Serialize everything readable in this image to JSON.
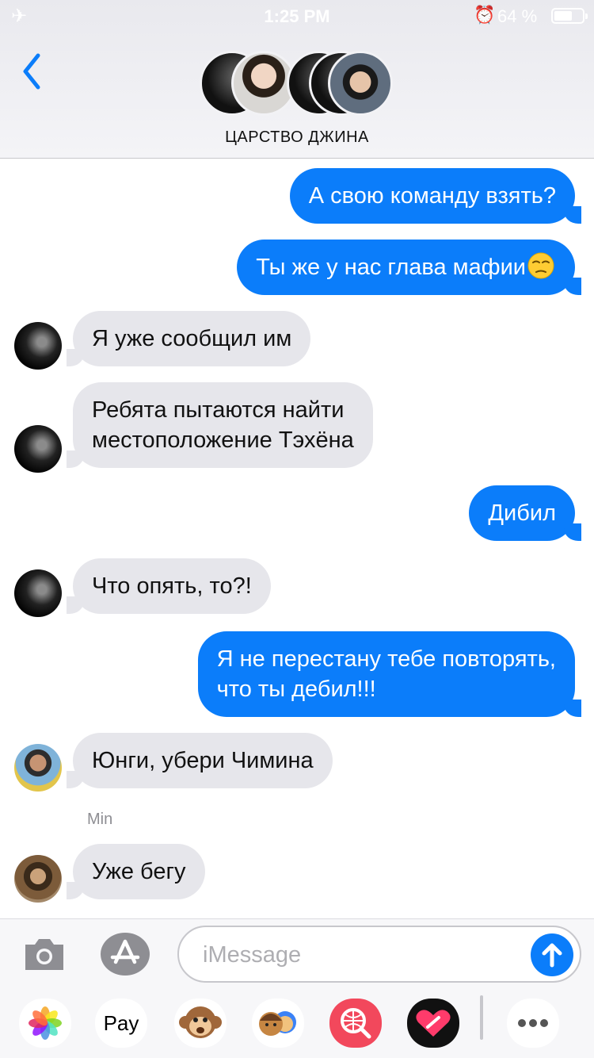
{
  "status_bar": {
    "time": "1:25 PM",
    "battery_percent": "64 %",
    "battery_level": 0.64,
    "airplane_icon": "airplane-icon",
    "alarm_icon": "alarm-icon"
  },
  "header": {
    "title": "ЦАРСТВО ДЖИНА",
    "back_icon": "chevron-left-icon",
    "avatar_count": 5
  },
  "messages": [
    {
      "direction": "out",
      "text": "А свою команду взять?"
    },
    {
      "direction": "out",
      "text": "Ты же у нас глава мафии",
      "emoji": "unamused-face"
    },
    {
      "direction": "in",
      "text": "Я уже сообщил им"
    },
    {
      "direction": "in",
      "line1": "Ребята пытаются найти",
      "line2": "местоположение Тэхёна"
    },
    {
      "direction": "out",
      "text": "Дибил"
    },
    {
      "direction": "in",
      "text": "Что опять, то?!"
    },
    {
      "direction": "out",
      "line1": "Я не перестану тебе повторять,",
      "line2": "что ты дебил!!!"
    },
    {
      "direction": "in",
      "text": "Юнги, убери Чимина"
    },
    {
      "direction": "in",
      "sender": "Min",
      "text": "Уже бегу"
    }
  ],
  "composer": {
    "placeholder": "iMessage",
    "camera_icon": "camera-icon",
    "appstore_icon": "app-store-icon",
    "send_icon": "arrow-up-icon"
  },
  "app_drawer": {
    "items": [
      "Photos",
      "Apple Pay",
      "Animoji",
      "Memoji",
      "Search",
      "Digital Touch",
      "More"
    ],
    "apple_pay_label": "Pay"
  },
  "colors": {
    "outgoing_bubble": "#0b7dfa",
    "incoming_bubble": "#e6e6eb",
    "accent": "#0b7dfa",
    "header_bg": "#ececf0"
  }
}
